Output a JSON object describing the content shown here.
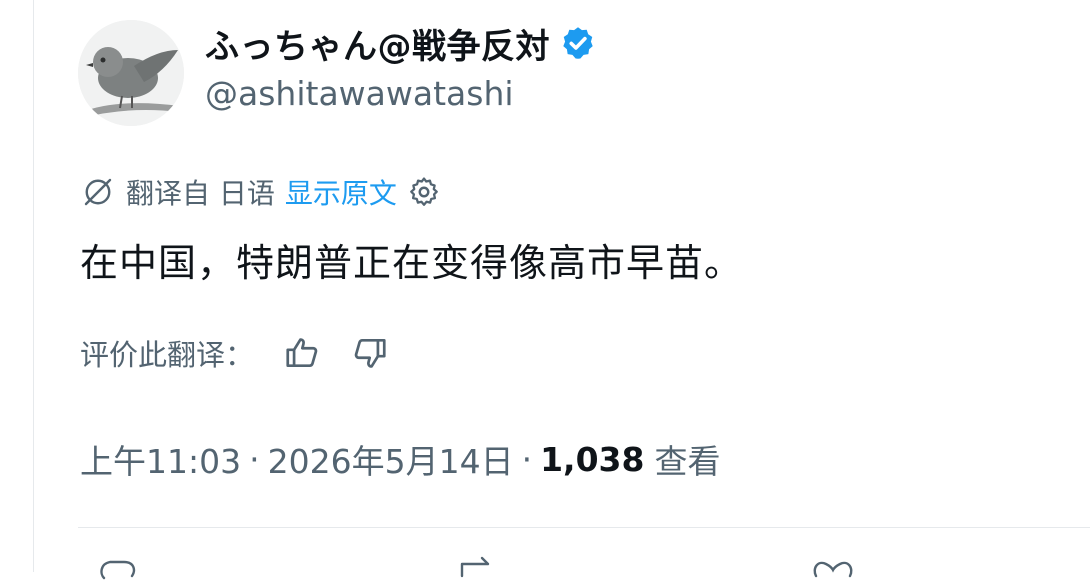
{
  "author": {
    "display_name": "ふっちゃん@戦争反対",
    "handle": "@ashitawawatashi",
    "verified": true,
    "verified_color": "#1d9bf0"
  },
  "translation": {
    "label": "翻译自 日语",
    "show_original": "显示原文"
  },
  "tweet": {
    "text": "在中国，特朗普正在变得像高市早苗。"
  },
  "rating": {
    "label": "评价此翻译："
  },
  "meta": {
    "time": "上午11:03",
    "date": "2026年5月14日",
    "views_count": "1,038",
    "views_label": "查看"
  },
  "colors": {
    "primary_text": "#0f1419",
    "secondary_text": "#536471",
    "accent": "#1d9bf0",
    "divider": "#e6e9ec"
  }
}
